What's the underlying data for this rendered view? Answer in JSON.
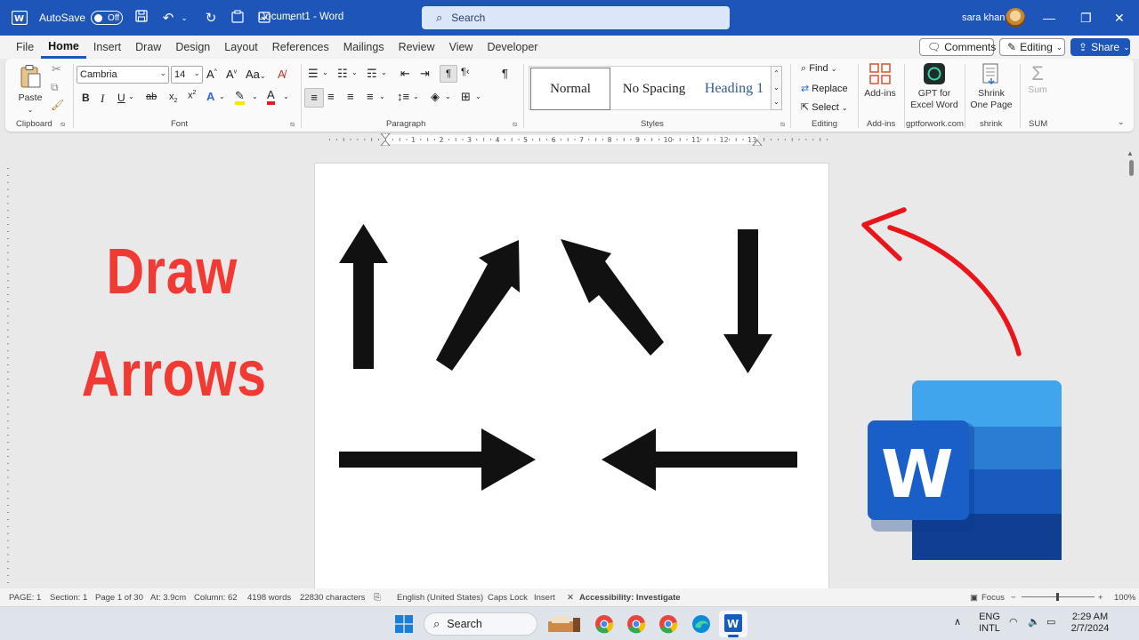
{
  "titlebar": {
    "autosave_label": "AutoSave",
    "autosave_state": "Off",
    "doc_title": "Document1  -  Word",
    "search_placeholder": "Search",
    "user_name": "sara khan"
  },
  "menu": {
    "tabs": [
      "File",
      "Home",
      "Insert",
      "Draw",
      "Design",
      "Layout",
      "References",
      "Mailings",
      "Review",
      "View",
      "Developer"
    ],
    "active": "Home",
    "comments": "Comments",
    "editing": "Editing",
    "share": "Share"
  },
  "ribbon": {
    "clipboard": {
      "paste": "Paste",
      "label": "Clipboard"
    },
    "font": {
      "family": "Cambria",
      "size": "14",
      "label": "Font"
    },
    "paragraph": {
      "label": "Paragraph"
    },
    "styles": {
      "normal": "Normal",
      "no_spacing": "No Spacing",
      "heading1": "Heading 1",
      "label": "Styles"
    },
    "editing": {
      "find": "Find",
      "replace": "Replace",
      "select": "Select",
      "label": "Editing"
    },
    "addins": {
      "button": "Add-ins",
      "label": "Add-ins"
    },
    "gpt": {
      "line1": "GPT for",
      "line2": "Excel Word",
      "label": "gptforwork.com"
    },
    "shrink": {
      "line1": "Shrink",
      "line2": "One Page",
      "label": "shrink"
    },
    "sum": {
      "button": "Sum",
      "label": "SUM"
    }
  },
  "ruler_numbers": [
    "1",
    "2",
    "3",
    "4",
    "5",
    "6",
    "7",
    "8",
    "9",
    "10",
    "11",
    "12",
    "13"
  ],
  "overlay": {
    "line1": "Draw",
    "line2": "Arrows"
  },
  "colors": {
    "accent": "#1d56b8",
    "title_red": "#f23a35",
    "arrow": "#111111",
    "curved_arrow": "#e8161b"
  },
  "statusbar": {
    "page": "PAGE: 1",
    "section": "Section: 1",
    "page_of": "Page 1 of 30",
    "at": "At: 3.9cm",
    "column": "Column: 62",
    "words": "4198 words",
    "chars": "22830 characters",
    "language": "English (United States)",
    "caps": "Caps Lock",
    "insert": "Insert",
    "accessibility": "Accessibility: Investigate",
    "focus": "Focus",
    "zoom": "100%"
  },
  "taskbar": {
    "search": "Search",
    "lang1": "ENG",
    "lang2": "INTL",
    "time": "2:29 AM",
    "date": "2/7/2024"
  }
}
